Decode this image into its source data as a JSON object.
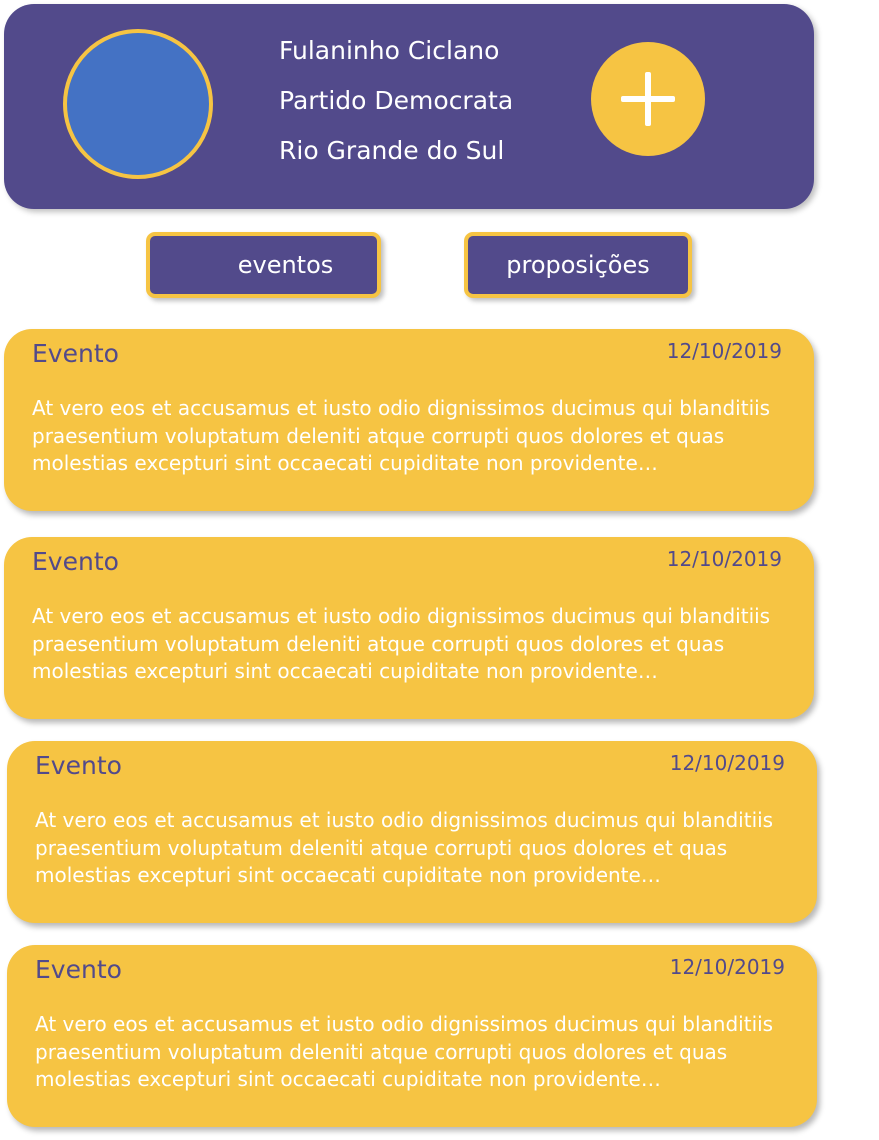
{
  "profile": {
    "name": "Fulaninho Ciclano",
    "party": "Partido Democrata",
    "state": "Rio Grande do Sul",
    "add_icon": "plus-icon"
  },
  "tabs": {
    "eventos": "eventos",
    "proposicoes": "proposições"
  },
  "events": [
    {
      "title": "Evento",
      "date": "12/10/2019",
      "description": "At vero eos et accusamus et iusto odio dignissimos ducimus qui blanditiis praesentium voluptatum deleniti atque corrupti quos dolores et quas molestias excepturi sint occaecati cupiditate non providente…"
    },
    {
      "title": "Evento",
      "date": "12/10/2019",
      "description": "At vero eos et accusamus et iusto odio dignissimos ducimus qui blanditiis praesentium voluptatum deleniti atque corrupti quos dolores et quas molestias excepturi sint occaecati cupiditate non providente…"
    },
    {
      "title": "Evento",
      "date": "12/10/2019",
      "description": "At vero eos et accusamus et iusto odio dignissimos ducimus qui blanditiis praesentium voluptatum deleniti atque corrupti quos dolores et quas molestias excepturi sint occaecati cupiditate non providente…"
    },
    {
      "title": "Evento",
      "date": "12/10/2019",
      "description": "At vero eos et accusamus et iusto odio dignissimos ducimus qui blanditiis praesentium voluptatum deleniti atque corrupti quos dolores et quas molestias excepturi sint occaecati cupiditate non providente…"
    }
  ],
  "colors": {
    "primary": "#524a8b",
    "accent": "#f6c443",
    "avatar": "#4472c4"
  }
}
